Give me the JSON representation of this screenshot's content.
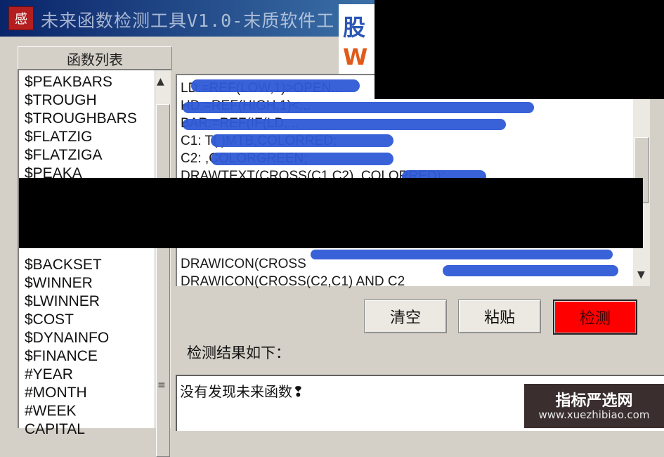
{
  "window": {
    "title": "未来函数检测工具V1.0-末质软件工",
    "icon_glyph": "感"
  },
  "watermark_logo": {
    "line1": "股",
    "line2": "W"
  },
  "function_list": {
    "header": "函数列表",
    "items": [
      "$PEAKBARS",
      "$TROUGH",
      "$TROUGHBARS",
      "$FLATZIG",
      "$FLATZIGA",
      "$PEAKA",
      "",
      "",
      "",
      "",
      "$BACKSET",
      "$WINNER",
      "$LWINNER",
      "$COST",
      "$DYNAINFO",
      "$FINANCE",
      "#YEAR",
      "#MONTH",
      "#WEEK",
      "CAPITAL"
    ]
  },
  "code_editor": {
    "lines": [
      "LD:=REF(LOW,1)>OPEN...",
      "HD:=REF(HIGH,1)<...",
      "BAR:=REF(IF(LD,...",
      "C1:         T(     )MTB,COLORRED;",
      "C2:               ,COLORGREEN;",
      "DRAWTEXT(CROSS(C1,C2)            ,COLORRED);",
      "",
      "",
      "",
      "",
      "DRAWICON(CROSS",
      "DRAWICON(CROSS(C2,C1) AND C2"
    ]
  },
  "buttons": {
    "clear": "清空",
    "paste": "粘贴",
    "check": "检测"
  },
  "result": {
    "label": "检测结果如下：",
    "text": "没有发现未来函数❢"
  },
  "site_badge": {
    "name": "指标严选网",
    "url": "www.xuezhibiao.com"
  },
  "colors": {
    "check_button": "#ff0000",
    "scribble": "#2e58d6"
  }
}
